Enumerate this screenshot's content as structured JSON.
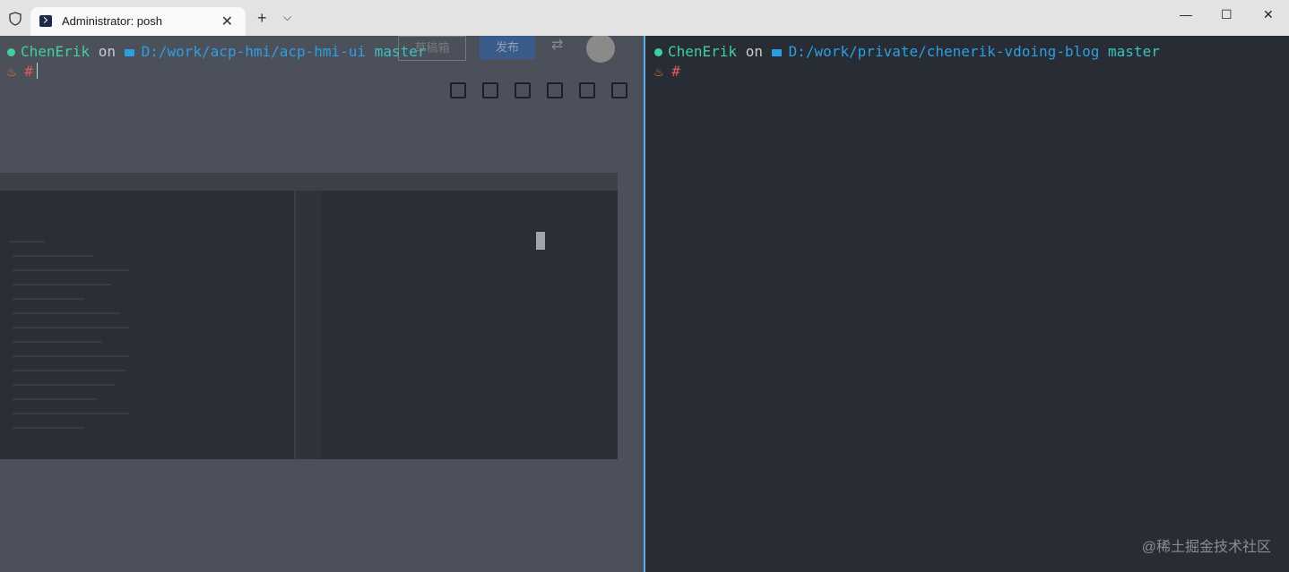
{
  "window": {
    "tab_title": "Administrator: posh",
    "tab_close": "✕",
    "new_tab": "+",
    "dropdown": "⌵",
    "minimize": "—",
    "maximize": "☐",
    "close": "✕"
  },
  "left_pane": {
    "user": "ChenErik",
    "on": "on",
    "path": "D:/work/acp-hmi/acp-hmi-ui",
    "branch_symbol": "",
    "branch": "master",
    "prompt": "#",
    "background_buttons": [
      "草稿箱",
      "发布"
    ]
  },
  "right_pane": {
    "user": "ChenErik",
    "on": "on",
    "path": "D:/work/private/chenerik-vdoing-blog",
    "branch_symbol": "",
    "branch": "master",
    "prompt": "#"
  },
  "watermark": "@稀土掘金技术社区",
  "colors": {
    "user": "#3fd0a0",
    "path": "#2d9fe0",
    "branch": "#3dc0c0",
    "prompt": "#e05a5a",
    "divider": "#5ab0e6"
  }
}
